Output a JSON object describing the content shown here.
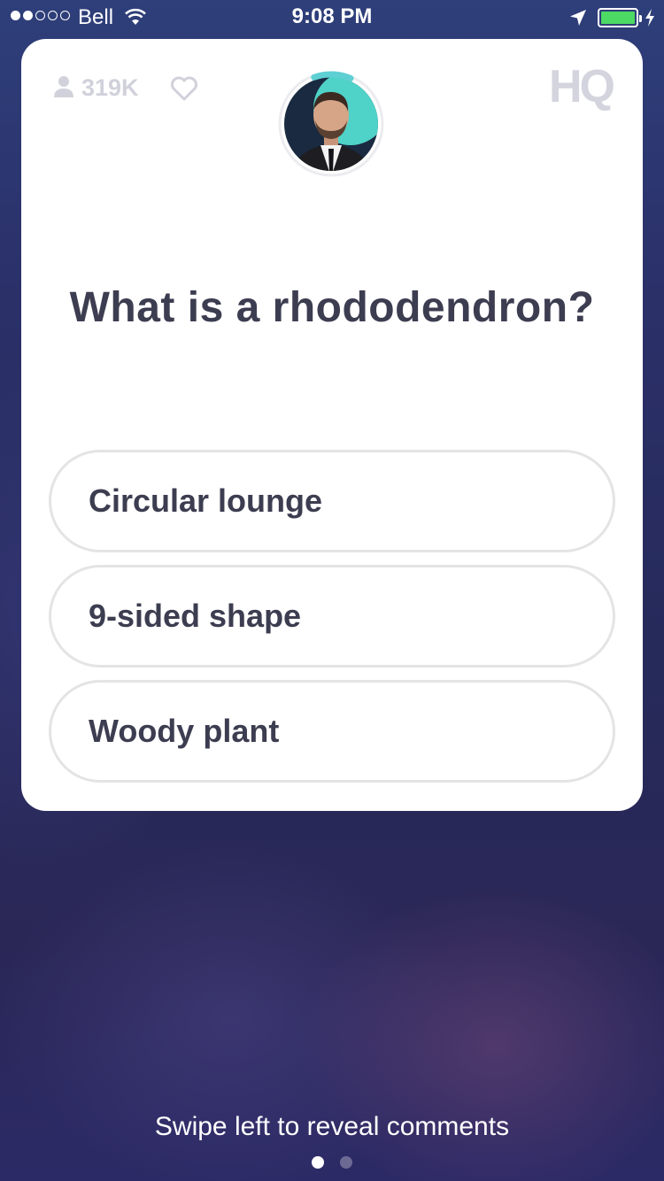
{
  "status_bar": {
    "carrier": "Bell",
    "time": "9:08 PM",
    "signal_bars_filled": 2,
    "signal_bars_total": 5,
    "battery_level": 1.0,
    "battery_color": "#4cd964",
    "icons": [
      "wifi-icon",
      "location-arrow-icon",
      "battery-icon",
      "charging-bolt-icon"
    ]
  },
  "header": {
    "viewer_count": "319K",
    "logo": "HQ",
    "icons": [
      "person-icon",
      "heart-icon"
    ]
  },
  "host": {
    "timer_remaining_fraction": 0.12,
    "timer_color": "#5ecfd3"
  },
  "question": {
    "text": "What is a rhododendron?"
  },
  "answers": [
    {
      "label": "Circular lounge"
    },
    {
      "label": "9-sided shape"
    },
    {
      "label": "Woody plant"
    }
  ],
  "footer": {
    "hint": "Swipe left to reveal comments",
    "pages_total": 2,
    "active_page": 1
  },
  "colors": {
    "card": "#ffffff",
    "text_dark": "#3c3d50",
    "answer_border": "#e4e4e6",
    "muted": "#d1d1db"
  }
}
